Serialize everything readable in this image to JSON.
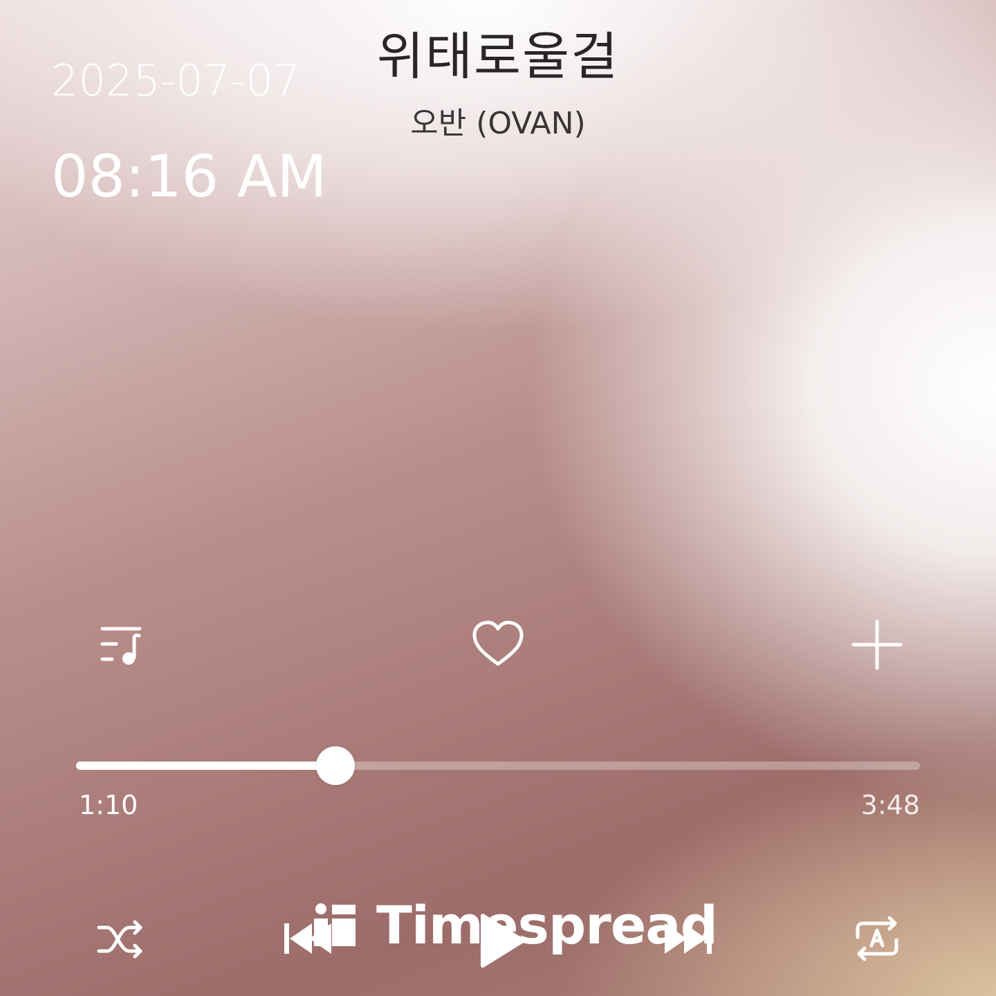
{
  "now_playing": {
    "title": "위태로울걸",
    "artist": "오반 (OVAN)"
  },
  "clock": {
    "date": "2025-07-07",
    "time": "08:16 AM"
  },
  "actions": {
    "playlist_icon": "playlist-music-icon",
    "like_icon": "heart-outline-icon",
    "add_icon": "plus-icon"
  },
  "progress": {
    "elapsed": "1:10",
    "total": "3:48",
    "fraction": 0.307
  },
  "controls": {
    "shuffle_icon": "shuffle-icon",
    "previous_icon": "skip-previous-icon",
    "play_icon": "play-icon",
    "next_icon": "skip-next-icon",
    "repeat_icon": "repeat-a-icon"
  },
  "watermark": {
    "text": "Timespread"
  },
  "colors": {
    "text_dark": "#2a2626",
    "icon": "#ffffff"
  }
}
